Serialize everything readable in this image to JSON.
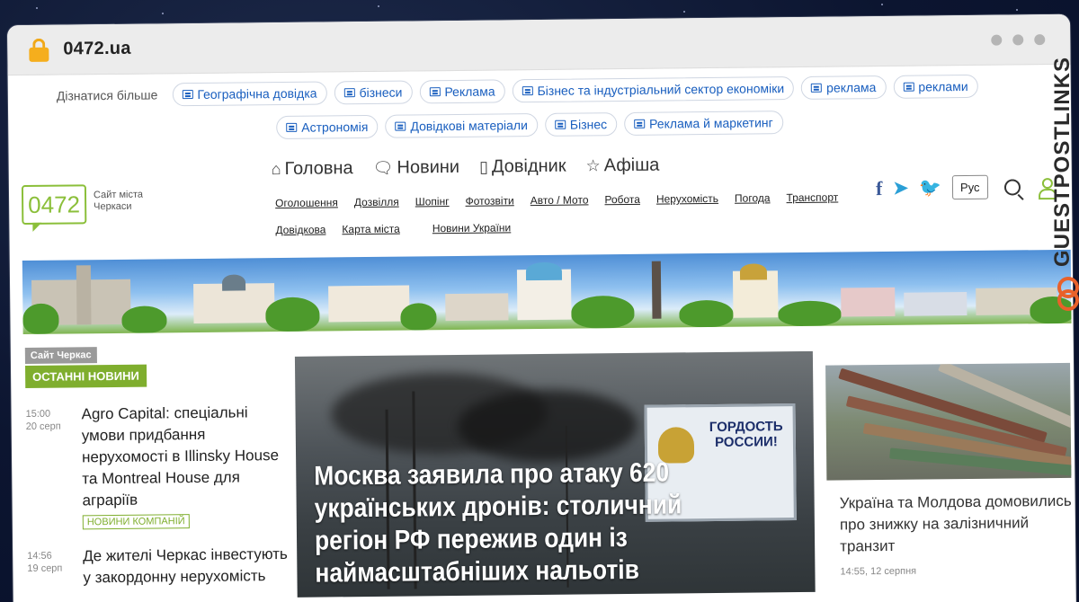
{
  "browser": {
    "url": "0472.ua"
  },
  "tags": {
    "learn_more": "Дізнатися більше",
    "row1": [
      "Географічна довідка",
      "бізнеси",
      "Реклама",
      "Бізнес та індустріальний сектор економіки",
      "реклама",
      "реклами"
    ],
    "row2": [
      "Астрономія",
      "Довідкові матеріали",
      "Бізнес",
      "Реклама й маркетинг"
    ]
  },
  "logo": {
    "number": "0472",
    "tagline": "Сайт міста Черкаси"
  },
  "nav": {
    "main": [
      {
        "label": "Головна",
        "icon": "⌂"
      },
      {
        "label": "Новини",
        "icon": "🗨"
      },
      {
        "label": "Довідник",
        "icon": "▯"
      },
      {
        "label": "Афіша",
        "icon": "☆"
      }
    ],
    "sub": [
      "Оголошення",
      "Дозвілля",
      "Шопінг",
      "Фотозвіти",
      "Авто / Мото",
      "Робота",
      "Нерухомість",
      "Погода",
      "Транспорт",
      "Довідкова",
      "Карта міста",
      "Новини України"
    ]
  },
  "header_tools": {
    "facebook": "f",
    "telegram": "➤",
    "twitter": "🐦",
    "language": "Рус"
  },
  "sidebar": {
    "crumb": "Сайт Черкас",
    "section": "ОСТАННІ НОВИНИ",
    "items": [
      {
        "time": "15:00",
        "date": "20 серп",
        "title": "Agro Capital: спеціальні умови придбання нерухомості в Illinsky House та Montreal House для аграріїв",
        "tag": "НОВИНИ КОМПАНІЙ"
      },
      {
        "time": "14:56",
        "date": "19 серп",
        "title": "Де жителі Черкас інвестують у закордонну нерухомість",
        "tag": ""
      }
    ]
  },
  "hero": {
    "title": "Москва заявила про атаку 620 українських дронів: столичний регіон РФ пережив один із наймасштабніших нальотів",
    "billboard_text": "ГОРДОСТЬ РОССИИ!"
  },
  "side_card": {
    "title": "Україна та Молдова домовились про знижку на залізничний транзит",
    "time": "14:55, 12 серпня"
  },
  "watermark": {
    "text": "GUESTPOSTLINKS"
  },
  "colors": {
    "accent_green": "#7fae2e",
    "link_blue": "#1a5fbf",
    "lock_orange": "#f5ae1d",
    "watermark_orange": "#e8612a"
  }
}
